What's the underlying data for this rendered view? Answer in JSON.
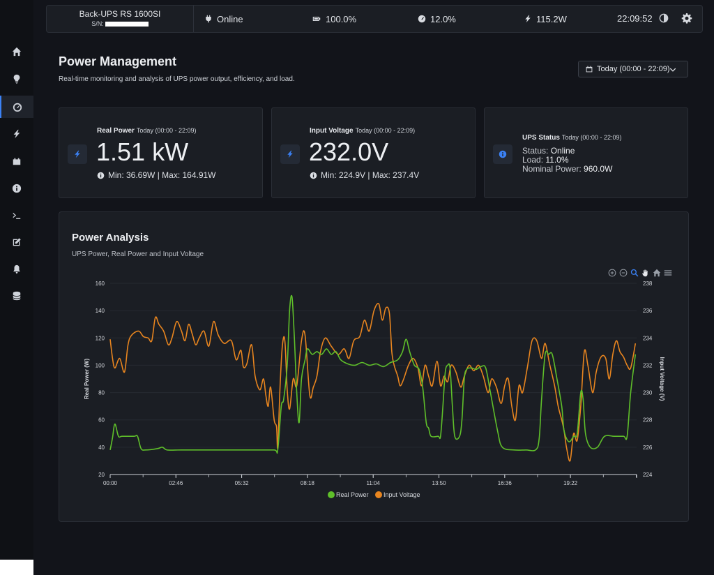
{
  "topbar": {
    "device_name": "Back-UPS RS 1600SI",
    "serial_label": "S/N:",
    "status": "Online",
    "battery": "100.0%",
    "load": "12.0%",
    "power": "115.2W",
    "clock": "22:09:52"
  },
  "sidebar": {
    "items": [
      {
        "icon": "home-icon"
      },
      {
        "icon": "lightbulb-icon"
      },
      {
        "icon": "gauge-icon",
        "active": true
      },
      {
        "icon": "lightning-icon"
      },
      {
        "icon": "battery-car-icon"
      },
      {
        "icon": "info-circle-icon"
      },
      {
        "icon": "terminal-icon"
      },
      {
        "icon": "edit-icon"
      },
      {
        "icon": "bell-icon"
      },
      {
        "icon": "database-icon"
      }
    ]
  },
  "header": {
    "title": "Power Management",
    "subtitle": "Real-time monitoring and analysis of UPS power output, efficiency, and load.",
    "date_range": "Today (00:00 - 22:09)"
  },
  "cards": {
    "real_power": {
      "title": "Real Power",
      "range": "Today (00:00 - 22:09)",
      "value": "1.51 kW",
      "minmax": "Min: 36.69W | Max: 164.91W"
    },
    "input_voltage": {
      "title": "Input Voltage",
      "range": "Today (00:00 - 22:09)",
      "value": "232.0V",
      "minmax": "Min: 224.9V | Max: 237.4V"
    },
    "ups_status": {
      "title": "UPS Status",
      "range": "Today (00:00 - 22:09)",
      "status_label": "Status:",
      "status_value": "Online",
      "load_label": "Load:",
      "load_value": "11.0%",
      "nominal_label": "Nominal Power:",
      "nominal_value": "960.0W"
    }
  },
  "chart": {
    "title": "Power Analysis",
    "subtitle": "UPS Power, Real Power and Input Voltage"
  },
  "colors": {
    "real_power": "#5fbf2a",
    "input_voltage": "#e8851f",
    "accent": "#3b82f6"
  },
  "chart_data": {
    "type": "line",
    "x_ticks": [
      "00:00",
      "02:46",
      "05:32",
      "08:18",
      "11:04",
      "13:50",
      "16:36",
      "19:22"
    ],
    "x_range_hours": [
      0,
      22.15
    ],
    "ylabel": "Real Power (W)",
    "y2label": "Input Voltage (V)",
    "ylim": [
      20,
      160
    ],
    "y_ticks": [
      20,
      40,
      60,
      80,
      100,
      120,
      140,
      160
    ],
    "y2lim": [
      224,
      238
    ],
    "y2_ticks": [
      224,
      226,
      228,
      230,
      232,
      234,
      236,
      238
    ],
    "grid": true,
    "legend": "bottom-center",
    "series": [
      {
        "name": "Real Power",
        "axis": "left",
        "points": [
          [
            0,
            38
          ],
          [
            0.1,
            47
          ],
          [
            0.2,
            57
          ],
          [
            0.35,
            48
          ],
          [
            0.5,
            48
          ],
          [
            1.0,
            48
          ],
          [
            1.15,
            48
          ],
          [
            1.3,
            39
          ],
          [
            1.5,
            38
          ],
          [
            2.0,
            39
          ],
          [
            2.2,
            40
          ],
          [
            2.4,
            38
          ],
          [
            3.0,
            38
          ],
          [
            4.0,
            38
          ],
          [
            5.0,
            38
          ],
          [
            6.0,
            38
          ],
          [
            6.9,
            38
          ],
          [
            7.05,
            38
          ],
          [
            7.2,
            70
          ],
          [
            7.3,
            75
          ],
          [
            7.45,
            100
          ],
          [
            7.55,
            140
          ],
          [
            7.65,
            150
          ],
          [
            7.75,
            120
          ],
          [
            7.85,
            80
          ],
          [
            7.95,
            58
          ],
          [
            8.05,
            90
          ],
          [
            8.2,
            104
          ],
          [
            8.3,
            112
          ],
          [
            8.5,
            108
          ],
          [
            8.7,
            110
          ],
          [
            8.9,
            108
          ],
          [
            9.1,
            112
          ],
          [
            9.3,
            108
          ],
          [
            9.5,
            110
          ],
          [
            9.7,
            104
          ],
          [
            10.0,
            101
          ],
          [
            10.3,
            100
          ],
          [
            10.6,
            102
          ],
          [
            10.9,
            100
          ],
          [
            11.2,
            101
          ],
          [
            11.5,
            99
          ],
          [
            11.8,
            102
          ],
          [
            12.1,
            104
          ],
          [
            12.3,
            110
          ],
          [
            12.45,
            119
          ],
          [
            12.6,
            110
          ],
          [
            12.8,
            100
          ],
          [
            13.0,
            97
          ],
          [
            13.15,
            84
          ],
          [
            13.3,
            58
          ],
          [
            13.4,
            54
          ],
          [
            13.5,
            48
          ],
          [
            13.8,
            48
          ],
          [
            13.9,
            48
          ],
          [
            14.0,
            70
          ],
          [
            14.1,
            95
          ],
          [
            14.2,
            100
          ],
          [
            14.3,
            98
          ],
          [
            14.4,
            70
          ],
          [
            14.5,
            48
          ],
          [
            14.7,
            48
          ],
          [
            14.8,
            60
          ],
          [
            14.9,
            90
          ],
          [
            15.0,
            97
          ],
          [
            15.2,
            98
          ],
          [
            15.4,
            97
          ],
          [
            15.6,
            99
          ],
          [
            15.8,
            98
          ],
          [
            16.0,
            80
          ],
          [
            16.3,
            52
          ],
          [
            16.5,
            40
          ],
          [
            17.0,
            38
          ],
          [
            17.5,
            38
          ],
          [
            17.9,
            38
          ],
          [
            18.05,
            46
          ],
          [
            18.15,
            75
          ],
          [
            18.3,
            108
          ],
          [
            18.45,
            108
          ],
          [
            18.6,
            108
          ],
          [
            18.8,
            90
          ],
          [
            19.0,
            70
          ],
          [
            19.1,
            52
          ],
          [
            19.3,
            44
          ],
          [
            19.5,
            48
          ],
          [
            19.65,
            50
          ],
          [
            19.8,
            80
          ],
          [
            19.9,
            75
          ],
          [
            20.0,
            50
          ],
          [
            20.2,
            40
          ],
          [
            20.5,
            40
          ],
          [
            20.8,
            48
          ],
          [
            21.2,
            48
          ],
          [
            21.6,
            48
          ],
          [
            21.75,
            48
          ],
          [
            21.9,
            80
          ],
          [
            22.1,
            108
          ]
        ]
      },
      {
        "name": "Input Voltage",
        "axis": "right",
        "points": [
          [
            0,
            233.9
          ],
          [
            0.1,
            232.5
          ],
          [
            0.2,
            231.8
          ],
          [
            0.4,
            232.5
          ],
          [
            0.6,
            231.5
          ],
          [
            0.75,
            233.5
          ],
          [
            0.9,
            234.2
          ],
          [
            1.2,
            234.5
          ],
          [
            1.4,
            234.1
          ],
          [
            1.6,
            234.0
          ],
          [
            1.75,
            233.8
          ],
          [
            1.9,
            235.5
          ],
          [
            2.05,
            235
          ],
          [
            2.25,
            234.5
          ],
          [
            2.45,
            233.5
          ],
          [
            2.6,
            234.0
          ],
          [
            2.8,
            235.2
          ],
          [
            3.0,
            234.5
          ],
          [
            3.15,
            233.8
          ],
          [
            3.3,
            235.0
          ],
          [
            3.45,
            234.3
          ],
          [
            3.6,
            233.5
          ],
          [
            3.75,
            234.0
          ],
          [
            3.95,
            234.5
          ],
          [
            4.15,
            233.4
          ],
          [
            4.35,
            235.2
          ],
          [
            4.55,
            234.2
          ],
          [
            4.8,
            233.6
          ],
          [
            5.1,
            233.8
          ],
          [
            5.3,
            232.4
          ],
          [
            5.5,
            233.1
          ],
          [
            5.6,
            231.9
          ],
          [
            5.75,
            232.1
          ],
          [
            5.95,
            233.5
          ],
          [
            6.1,
            231.2
          ],
          [
            6.3,
            230.2
          ],
          [
            6.45,
            231.0
          ],
          [
            6.55,
            229.8
          ],
          [
            6.65,
            229.0
          ],
          [
            6.75,
            230.4
          ],
          [
            6.9,
            228.0
          ],
          [
            7.0,
            227.5
          ],
          [
            7.05,
            226.0
          ],
          [
            7.15,
            230.5
          ],
          [
            7.25,
            233.5
          ],
          [
            7.35,
            233.8
          ],
          [
            7.45,
            230.2
          ],
          [
            7.55,
            228.8
          ],
          [
            7.7,
            231.0
          ],
          [
            7.85,
            230.5
          ],
          [
            8.05,
            233.8
          ],
          [
            8.2,
            234.2
          ],
          [
            8.4,
            229.8
          ],
          [
            8.55,
            230.4
          ],
          [
            8.7,
            231.2
          ],
          [
            8.85,
            233.0
          ],
          [
            9.05,
            234.0
          ],
          [
            9.3,
            233.4
          ],
          [
            9.6,
            232.8
          ],
          [
            9.85,
            233.2
          ],
          [
            10.05,
            232.5
          ],
          [
            10.25,
            233.8
          ],
          [
            10.5,
            234.1
          ],
          [
            10.7,
            235.3
          ],
          [
            10.9,
            234.5
          ],
          [
            11.1,
            236.0
          ],
          [
            11.3,
            236.5
          ],
          [
            11.45,
            235.3
          ],
          [
            11.6,
            236.2
          ],
          [
            11.75,
            235.8
          ],
          [
            11.85,
            233.0
          ],
          [
            11.95,
            232.0
          ],
          [
            12.1,
            231.2
          ],
          [
            12.2,
            230.5
          ],
          [
            12.35,
            231.0
          ],
          [
            12.55,
            232.0
          ],
          [
            12.75,
            232.5
          ],
          [
            12.95,
            231.8
          ],
          [
            13.1,
            230.5
          ],
          [
            13.25,
            232.0
          ],
          [
            13.4,
            231.2
          ],
          [
            13.55,
            230.5
          ],
          [
            13.75,
            232.3
          ],
          [
            13.9,
            230.5
          ],
          [
            14.05,
            231.2
          ],
          [
            14.2,
            230.8
          ],
          [
            14.35,
            232.0
          ],
          [
            14.55,
            231.5
          ],
          [
            14.75,
            230.4
          ],
          [
            14.9,
            231.2
          ],
          [
            15.1,
            232.0
          ],
          [
            15.3,
            231.6
          ],
          [
            15.5,
            232.0
          ],
          [
            15.7,
            231.2
          ],
          [
            15.9,
            230.0
          ],
          [
            16.05,
            231.0
          ],
          [
            16.25,
            230.4
          ],
          [
            16.45,
            229.2
          ],
          [
            16.6,
            230.5
          ],
          [
            16.75,
            231.0
          ],
          [
            16.9,
            229.0
          ],
          [
            17.05,
            228.0
          ],
          [
            17.2,
            230.5
          ],
          [
            17.35,
            230.0
          ],
          [
            17.55,
            231.8
          ],
          [
            17.75,
            233.8
          ],
          [
            17.95,
            233.8
          ],
          [
            18.15,
            232.5
          ],
          [
            18.3,
            233.6
          ],
          [
            18.5,
            232.0
          ],
          [
            18.7,
            230.5
          ],
          [
            18.85,
            229.0
          ],
          [
            19.0,
            228.0
          ],
          [
            19.1,
            227.2
          ],
          [
            19.2,
            226.0
          ],
          [
            19.35,
            225.0
          ],
          [
            19.5,
            227.0
          ],
          [
            19.65,
            226.5
          ],
          [
            19.8,
            229.0
          ],
          [
            19.95,
            233.0
          ],
          [
            20.1,
            232.0
          ],
          [
            20.3,
            230.0
          ],
          [
            20.45,
            231.5
          ],
          [
            20.65,
            232.6
          ],
          [
            20.85,
            232.5
          ],
          [
            21.0,
            231.0
          ],
          [
            21.15,
            232.8
          ],
          [
            21.3,
            233.8
          ],
          [
            21.45,
            233.0
          ],
          [
            21.6,
            232.6
          ],
          [
            21.75,
            232.0
          ],
          [
            21.9,
            231.8
          ],
          [
            22.1,
            233.6
          ]
        ]
      }
    ]
  }
}
